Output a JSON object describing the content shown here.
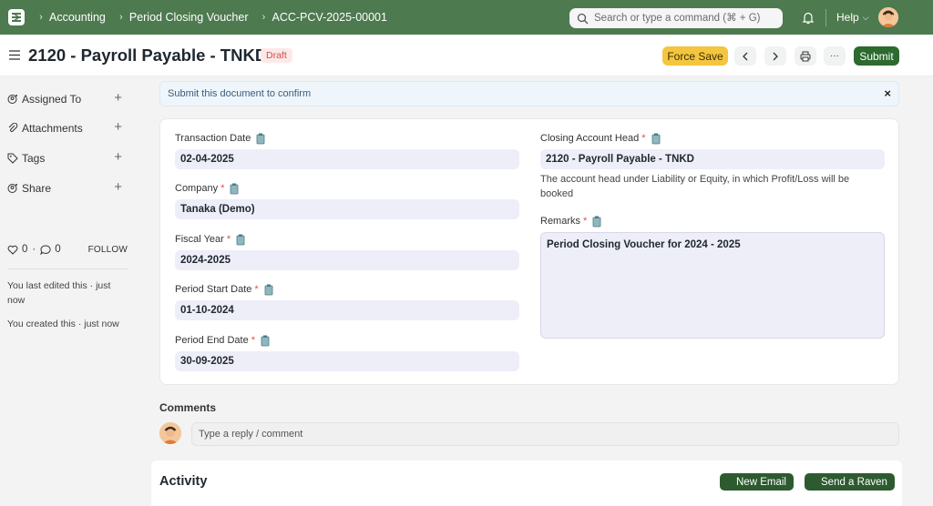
{
  "navbar": {
    "breadcrumbs": [
      "Accounting",
      "Period Closing Voucher",
      "ACC-PCV-2025-00001"
    ],
    "search_placeholder": "Search or type a command (⌘ + G)",
    "help_label": "Help",
    "accent_color": "#4d7a4f"
  },
  "page": {
    "title": "2120 - Payroll Payable - TNKD",
    "status": "Draft",
    "force_save_label": "Force Save",
    "submit_label": "Submit",
    "more_label": "···"
  },
  "sidebar": {
    "items": [
      {
        "label": "Assigned To",
        "icon": "assign-icon"
      },
      {
        "label": "Attachments",
        "icon": "paperclip-icon"
      },
      {
        "label": "Tags",
        "icon": "tag-icon"
      },
      {
        "label": "Share",
        "icon": "share-icon"
      }
    ],
    "likes": "0",
    "comments": "0",
    "follow_label": "FOLLOW",
    "last_edited": "You last edited this · just now",
    "created": "You created this · just now"
  },
  "alert": {
    "message": "Submit this document to confirm",
    "close": "×"
  },
  "form": {
    "transaction_date": {
      "label": "Transaction Date",
      "value": "02-04-2025"
    },
    "company": {
      "label": "Company",
      "value": "Tanaka (Demo)"
    },
    "fiscal_year": {
      "label": "Fiscal Year",
      "value": "2024-2025"
    },
    "period_start_date": {
      "label": "Period Start Date",
      "value": "01-10-2024"
    },
    "period_end_date": {
      "label": "Period End Date",
      "value": "30-09-2025"
    },
    "closing_account_head": {
      "label": "Closing Account Head",
      "value": "2120 - Payroll Payable - TNKD",
      "description": "The account head under Liability or Equity, in which Profit/Loss will be booked"
    },
    "remarks": {
      "label": "Remarks",
      "value": "Period Closing Voucher for 2024 - 2025"
    },
    "required_mark": "*"
  },
  "comments": {
    "heading": "Comments",
    "placeholder": "Type a reply / comment"
  },
  "activity": {
    "heading": "Activity",
    "new_email_label": "New Email",
    "send_raven_label": "Send a Raven"
  }
}
